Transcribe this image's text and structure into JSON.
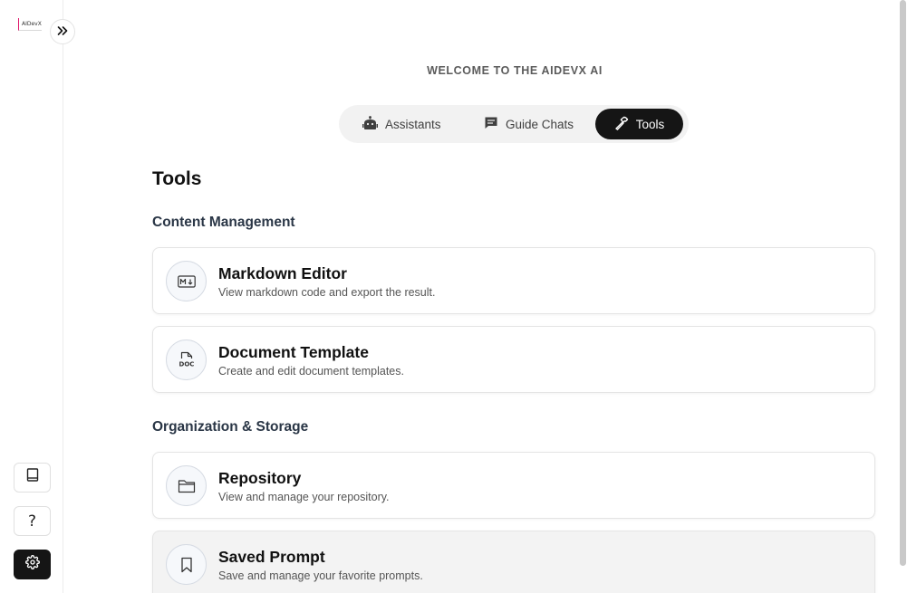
{
  "app": {
    "logo_text": "AIDevX"
  },
  "header": {
    "welcome": "WELCOME TO THE AIDEVX AI"
  },
  "tabs": [
    {
      "label": "Assistants",
      "icon": "robot-icon",
      "active": false
    },
    {
      "label": "Guide Chats",
      "icon": "chat-icon",
      "active": false
    },
    {
      "label": "Tools",
      "icon": "hammer-icon",
      "active": true
    }
  ],
  "main": {
    "title": "Tools",
    "sections": [
      {
        "title": "Content Management",
        "items": [
          {
            "title": "Markdown Editor",
            "description": "View markdown code and export the result.",
            "icon": "markdown-icon"
          },
          {
            "title": "Document Template",
            "description": "Create and edit document templates.",
            "icon": "doc-file-icon",
            "icon_text": "DOC"
          }
        ]
      },
      {
        "title": "Organization & Storage",
        "items": [
          {
            "title": "Repository",
            "description": "View and manage your repository.",
            "icon": "folder-icon"
          },
          {
            "title": "Saved Prompt",
            "description": "Save and manage your favorite prompts.",
            "icon": "bookmark-icon"
          }
        ]
      }
    ]
  },
  "sidebar": {
    "expand_icon": "double-chevron-right-icon",
    "buttons": [
      {
        "icon": "book-icon"
      },
      {
        "icon": "help-icon",
        "glyph": "?"
      },
      {
        "icon": "gear-icon"
      }
    ]
  },
  "colors": {
    "accent_dark": "#151515",
    "tab_bg": "#f2f2f2",
    "card_border": "#e4e4e4",
    "logo_accent": "#e1196c"
  }
}
